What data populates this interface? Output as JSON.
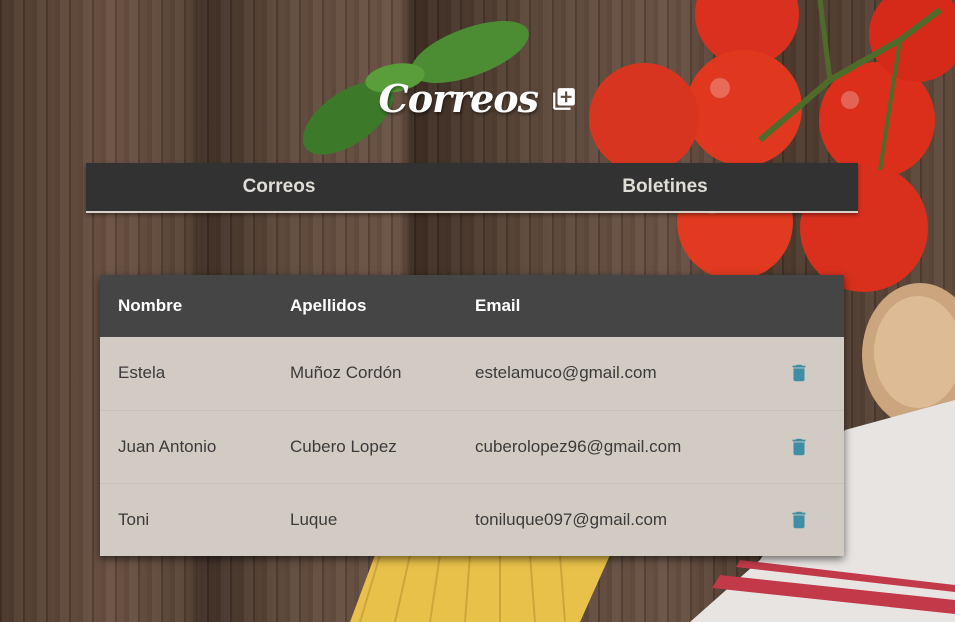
{
  "header": {
    "title": "Correos",
    "add_icon": "add-box-icon"
  },
  "tabs": [
    {
      "label": "Correos"
    },
    {
      "label": "Boletines"
    }
  ],
  "table": {
    "columns": [
      "Nombre",
      "Apellidos",
      "Email",
      ""
    ],
    "rows": [
      {
        "nombre": "Estela",
        "apellidos": "Muñoz Cordón",
        "email": "estelamuco@gmail.com",
        "action_icon": "trash-icon"
      },
      {
        "nombre": "Juan Antonio",
        "apellidos": "Cubero Lopez",
        "email": "cuberolopez96@gmail.com",
        "action_icon": "trash-icon"
      },
      {
        "nombre": "Toni",
        "apellidos": "Luque",
        "email": "toniluque097@gmail.com",
        "action_icon": "trash-icon"
      }
    ]
  },
  "colors": {
    "tab_bar": "#323232",
    "table_header": "#454545",
    "table_body": "#d2cbc3",
    "trash_icon": "#3f8ea8"
  }
}
